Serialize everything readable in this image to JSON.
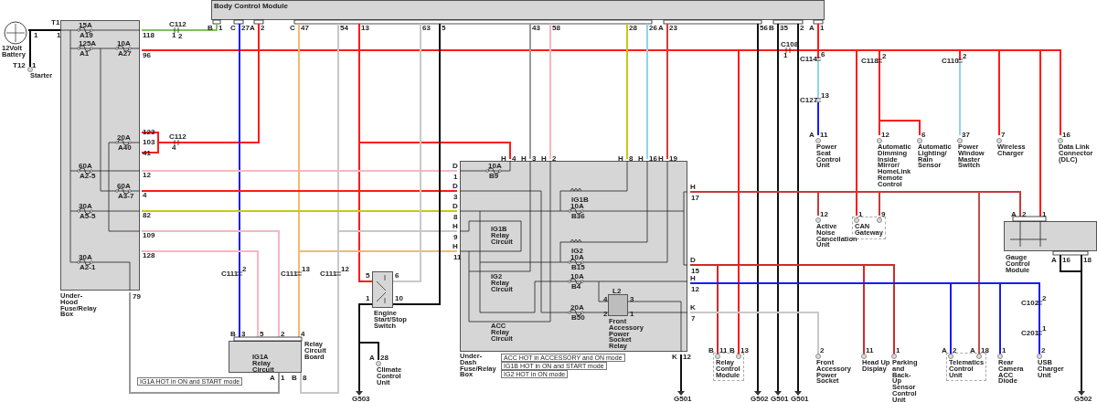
{
  "battery": {
    "label": "12Volt Battery",
    "pin": "1"
  },
  "starter": {
    "label": "Starter",
    "connector": "T12",
    "pin": "1"
  },
  "body_control_module": {
    "title": "Body Control Module",
    "pins": [
      {
        "connector": "B",
        "pin": "1"
      },
      {
        "connector": "C",
        "pin": "27"
      },
      {
        "connector": "A",
        "pin": "2"
      },
      {
        "connector": "C",
        "pin": "47"
      },
      {
        "pin": "54"
      },
      {
        "pin": "13"
      },
      {
        "pin": "63"
      },
      {
        "pin": "5"
      },
      {
        "pin": "43"
      },
      {
        "pin": "58"
      },
      {
        "pin": "28"
      },
      {
        "pin": "26"
      },
      {
        "connector": "A",
        "pin": "23"
      },
      {
        "pin": "56"
      },
      {
        "connector": "B",
        "pin": "35"
      },
      {
        "pin": "2"
      },
      {
        "connector": "A",
        "pin": "1"
      }
    ]
  },
  "under_hood_box": {
    "title": "Under-Hood Fuse/Relay Box",
    "connector": "T1",
    "input_pin": "1",
    "fuses": [
      {
        "rating": "15A",
        "id": "A19"
      },
      {
        "rating": "125A",
        "id": "A1"
      },
      {
        "rating": "10A",
        "id": "A27"
      },
      {
        "rating": "20A",
        "id": "A40"
      },
      {
        "rating": "60A",
        "id": "A2-5"
      },
      {
        "rating": "60A",
        "id": "A3-7"
      },
      {
        "rating": "30A",
        "id": "A5-5"
      },
      {
        "rating": "30A",
        "id": "A2-1"
      }
    ],
    "pins": [
      "118",
      "96",
      "123",
      "103",
      "41",
      "12",
      "4",
      "82",
      "109",
      "128",
      "79"
    ]
  },
  "connectors": [
    {
      "name": "C112",
      "pins": [
        "1",
        "2"
      ]
    },
    {
      "name": "C112",
      "pins": [
        "4"
      ]
    },
    {
      "name": "C108",
      "pins": [
        "1"
      ]
    },
    {
      "name": "C114",
      "pins": [
        "6"
      ]
    },
    {
      "name": "C118",
      "pins": [
        "2"
      ]
    },
    {
      "name": "C110",
      "pins": [
        "2"
      ]
    },
    {
      "name": "C127",
      "pins": [
        "13"
      ]
    },
    {
      "name": "C111",
      "pins": [
        "2"
      ]
    },
    {
      "name": "C111",
      "pins": [
        "13"
      ]
    },
    {
      "name": "C111",
      "pins": [
        "12"
      ]
    },
    {
      "name": "C102",
      "pins": [
        "2"
      ]
    },
    {
      "name": "C201",
      "pins": [
        "1"
      ]
    }
  ],
  "under_dash_box": {
    "title": "Under-Dash Fuse/Relay Box",
    "top_pins": [
      {
        "connector": "H",
        "pin": "4"
      },
      {
        "connector": "H",
        "pin": "3"
      },
      {
        "connector": "H",
        "pin": "2"
      },
      {
        "connector": "H",
        "pin": "8"
      },
      {
        "connector": "H",
        "pin": "16"
      },
      {
        "connector": "H",
        "pin": "19"
      }
    ],
    "left_pins": [
      {
        "connector": "D",
        "pin": "1"
      },
      {
        "connector": "D",
        "pin": "3"
      },
      {
        "connector": "D",
        "pin": "8"
      },
      {
        "connector": "H",
        "pin": "9"
      },
      {
        "connector": "H",
        "pin": "11"
      }
    ],
    "right_pins": [
      {
        "connector": "H",
        "pin": "17"
      },
      {
        "connector": "D",
        "pin": "15"
      },
      {
        "connector": "H",
        "pin": "12"
      },
      {
        "connector": "K",
        "pin": "7"
      }
    ],
    "bottom_pin": {
      "connector": "K",
      "pin": "12"
    },
    "fuses": [
      {
        "rating": "10A",
        "id": "B9"
      },
      {
        "rating": "10A",
        "id": "B36"
      },
      {
        "rating": "10A",
        "id": "B15"
      },
      {
        "rating": "10A",
        "id": "B4"
      },
      {
        "rating": "20A",
        "id": "B50"
      }
    ],
    "relay_coils": [
      "IG1B",
      "IG2"
    ],
    "relay_circuits": [
      "IG1B Relay Circuit",
      "IG2 Relay Circuit",
      "ACC Relay Circuit"
    ],
    "socket_relay": {
      "name": "L2",
      "label": "Front Accessory Power Socket Relay",
      "pins": [
        "4",
        "3",
        "2",
        "1"
      ]
    },
    "notes": [
      "ACC HOT in ACCESSORY and ON mode",
      "IG1B HOT in ON and START mode",
      "IG2 HOT in ON mode"
    ]
  },
  "engine_switch": {
    "label": "Engine Start/Stop Switch",
    "pins": [
      "5",
      "6",
      "1",
      "10"
    ]
  },
  "relay_circuit_board": {
    "title": "Relay Circuit Board",
    "circuit": "IG1A Relay Circuit",
    "top_pins": [
      {
        "connector": "B",
        "pin": "3"
      },
      {
        "pin": "5"
      },
      {
        "pin": "2"
      },
      {
        "pin": "4"
      }
    ],
    "bottom_pins": [
      {
        "connector": "A",
        "pin": "1"
      },
      {
        "connector": "B",
        "pin": "8"
      }
    ],
    "note": "IG1A HOT in ON and START mode"
  },
  "gauge_control_module": {
    "label": "Gauge Control Module",
    "top_pins": [
      {
        "connector": "A",
        "pin": "2"
      },
      {
        "pin": "1"
      }
    ],
    "bottom_pins": [
      {
        "connector": "A",
        "pin": "16"
      },
      {
        "pin": "18"
      }
    ]
  },
  "components": [
    {
      "label": "Power Seat Control Unit",
      "pins": [
        {
          "connector": "A",
          "pin": "11"
        }
      ],
      "outlined": false
    },
    {
      "label": "Automatic Dimming Inside Mirror/ HomeLink Remote Control",
      "pins": [
        {
          "pin": "12"
        }
      ],
      "outlined": false
    },
    {
      "label": "Automatic Lighting/ Rain Sensor",
      "pins": [
        {
          "pin": "6"
        }
      ],
      "outlined": false
    },
    {
      "label": "Power Window Master Switch",
      "pins": [
        {
          "pin": "37"
        }
      ],
      "outlined": false
    },
    {
      "label": "Wireless Charger",
      "pins": [
        {
          "pin": "7"
        }
      ],
      "outlined": false
    },
    {
      "label": "Data Link Connector (DLC)",
      "pins": [
        {
          "pin": "16"
        }
      ],
      "outlined": false
    },
    {
      "label": "Active Noise Cancellation Unit",
      "pins": [
        {
          "pin": "12"
        }
      ],
      "outlined": false
    },
    {
      "label": "CAN Gateway",
      "pins": [
        {
          "pin": "1"
        },
        {
          "pin": "9"
        }
      ],
      "outlined": true
    },
    {
      "label": "Climate Control Unit",
      "pins": [
        {
          "connector": "A",
          "pin": "28"
        }
      ],
      "outlined": false
    },
    {
      "label": "Relay Control Module",
      "pins": [
        {
          "connector": "B",
          "pin": "11"
        },
        {
          "connector": "B",
          "pin": "13"
        }
      ],
      "outlined": true
    },
    {
      "label": "Front Accessory Power Socket",
      "pins": [
        {
          "pin": "2"
        }
      ],
      "outlined": false
    },
    {
      "label": "Head Up Display",
      "pins": [
        {
          "pin": "11"
        }
      ],
      "outlined": false
    },
    {
      "label": "Parking and Back-Up Sensor Control Unit",
      "pins": [
        {
          "pin": "1"
        }
      ],
      "outlined": false
    },
    {
      "label": "Telematics Control Unit",
      "pins": [
        {
          "connector": "A",
          "pin": "2"
        },
        {
          "connector": "A",
          "pin": "18"
        }
      ],
      "outlined": true
    },
    {
      "label": "Rear Camera ACC Diode",
      "pins": [
        {
          "pin": "1"
        }
      ],
      "outlined": false
    },
    {
      "label": "USB Charger Unit",
      "pins": [
        {
          "pin": "2"
        }
      ],
      "outlined": false
    }
  ],
  "grounds": [
    "G503",
    "G501",
    "G502",
    "G501",
    "G501",
    "G502"
  ]
}
